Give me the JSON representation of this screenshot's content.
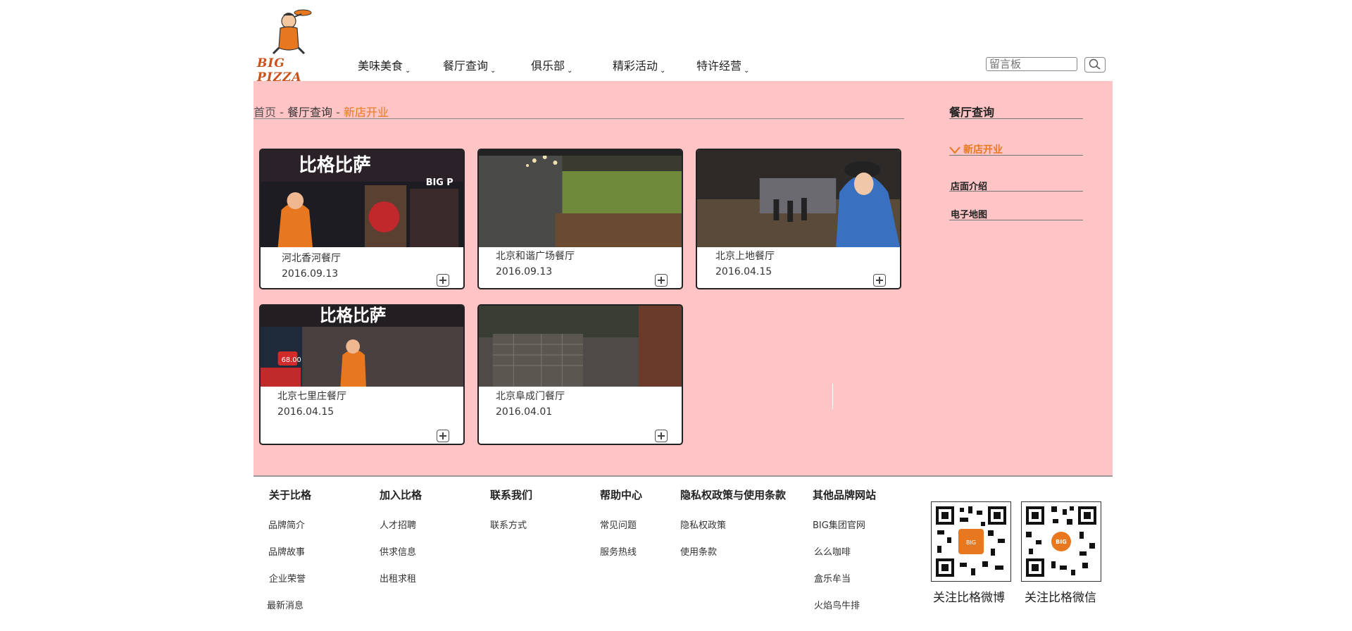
{
  "header": {
    "logo_text": "BIG PIZZA",
    "nav": [
      {
        "label": "美味美食"
      },
      {
        "label": "餐厅查询"
      },
      {
        "label": "俱乐部"
      },
      {
        "label": "精彩活动"
      },
      {
        "label": "特许经营"
      }
    ],
    "search": {
      "placeholder": "留言板",
      "value": ""
    }
  },
  "breadcrumb": {
    "home": "首页",
    "sep": " - ",
    "section": "餐厅查询",
    "current": "新店开业"
  },
  "cards": [
    {
      "name": "河北香河餐厅",
      "date": "2016.09.13"
    },
    {
      "name": "北京和谐广场餐厅",
      "date": "2016.09.13"
    },
    {
      "name": "北京上地餐厅",
      "date": "2016.04.15"
    },
    {
      "name": "北京七里庄餐厅",
      "date": "2016.04.15"
    },
    {
      "name": "北京阜成门餐厅",
      "date": "2016.04.01"
    }
  ],
  "sidebar": {
    "title": "餐厅查询",
    "items": [
      {
        "label": "新店开业",
        "active": true
      },
      {
        "label": "店面介绍"
      },
      {
        "label": "电子地图"
      }
    ]
  },
  "footer": {
    "columns": [
      {
        "heading": "关于比格",
        "links": [
          "品牌简介",
          "品牌故事",
          "企业荣誉",
          "最新消息"
        ]
      },
      {
        "heading": "加入比格",
        "links": [
          "人才招聘",
          "供求信息",
          "出租求租"
        ]
      },
      {
        "heading": "联系我们",
        "links": [
          "联系方式"
        ]
      },
      {
        "heading": "帮助中心",
        "links": [
          "常见问题",
          "服务热线"
        ]
      },
      {
        "heading": "隐私权政策与使用条款",
        "links": [
          "隐私权政策",
          "使用条款"
        ]
      },
      {
        "heading": "其他品牌网站",
        "links": [
          "BIG集团官网",
          "么么咖啡",
          "盒乐牟当",
          "火焰鸟牛排"
        ]
      }
    ],
    "qr": [
      {
        "label": "关注比格微博",
        "badge": "BIG"
      },
      {
        "label": "关注比格微信",
        "badge": "BIG"
      }
    ]
  },
  "colors": {
    "accent": "#e7781f",
    "panel": "#ffc4c6"
  }
}
